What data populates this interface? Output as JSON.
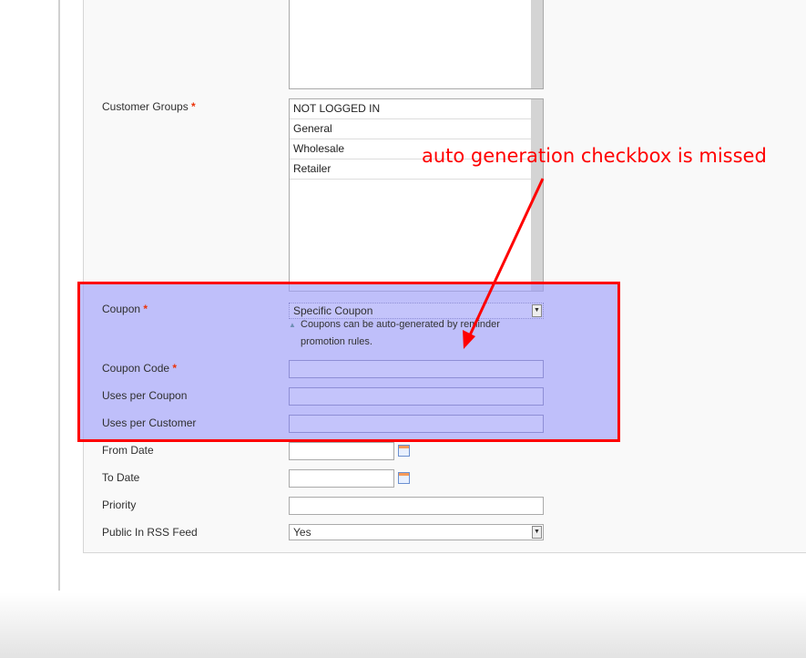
{
  "form": {
    "customer_groups": {
      "label": "Customer Groups",
      "required": "*",
      "options": [
        "NOT LOGGED IN",
        "General",
        "Wholesale",
        "Retailer"
      ]
    },
    "coupon": {
      "label": "Coupon",
      "required": "*",
      "value": "Specific Coupon",
      "note": "Coupons can be auto-generated by reminder promotion rules."
    },
    "coupon_code": {
      "label": "Coupon Code",
      "required": "*",
      "value": ""
    },
    "uses_per_coupon": {
      "label": "Uses per Coupon",
      "value": ""
    },
    "uses_per_customer": {
      "label": "Uses per Customer",
      "value": ""
    },
    "from_date": {
      "label": "From Date",
      "value": ""
    },
    "to_date": {
      "label": "To Date",
      "value": ""
    },
    "priority": {
      "label": "Priority",
      "value": ""
    },
    "public_rss": {
      "label": "Public In RSS Feed",
      "value": "Yes"
    }
  },
  "annotation": {
    "text": "auto generation checkbox is missed",
    "color": "#ff0000"
  },
  "icons": {
    "calendar": "calendar-icon",
    "dropdown": "chevron-down-icon",
    "note": "triangle-up-icon"
  }
}
